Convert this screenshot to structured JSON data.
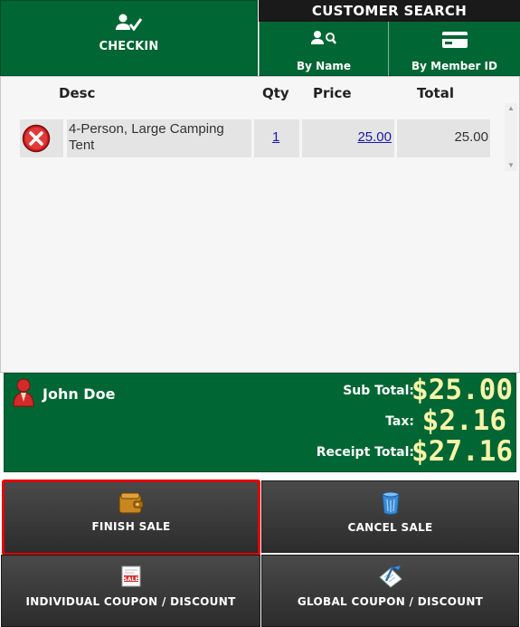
{
  "header": {
    "checkin": {
      "label": "CHECKIN",
      "icon": "user-check-icon"
    },
    "customer_search": {
      "title": "CUSTOMER SEARCH",
      "by_name": {
        "label": "By Name",
        "icon": "user-search-icon"
      },
      "by_member": {
        "label": "By Member ID",
        "icon": "member-card-icon"
      }
    }
  },
  "table": {
    "columns": {
      "desc": "Desc",
      "qty": "Qty",
      "price": "Price",
      "total": "Total"
    },
    "rows": [
      {
        "desc": "4-Person, Large Camping Tent",
        "qty": "1",
        "price": "25.00",
        "total": "25.00"
      }
    ]
  },
  "totals": {
    "customer_name": "John Doe",
    "sub_total_label": "Sub Total:",
    "sub_total": "$25.00",
    "tax_label": "Tax:",
    "tax": "$2.16",
    "receipt_total_label": "Receipt Total:",
    "receipt_total": "$27.16"
  },
  "actions": {
    "finish": {
      "label": "FINISH SALE",
      "icon": "wallet-icon"
    },
    "cancel": {
      "label": "CANCEL SALE",
      "icon": "trash-can-icon"
    },
    "individual_coupon": {
      "label": "INDIVIDUAL COUPON / DISCOUNT",
      "icon": "sale-tag-icon"
    },
    "global_coupon": {
      "label": "GLOBAL COUPON / DISCOUNT",
      "icon": "notepad-pen-icon"
    }
  },
  "colors": {
    "brand_green": "#006633",
    "total_value": "#f7f4a8",
    "highlight_red": "#e30000",
    "link_blue": "#1a1aa6"
  }
}
